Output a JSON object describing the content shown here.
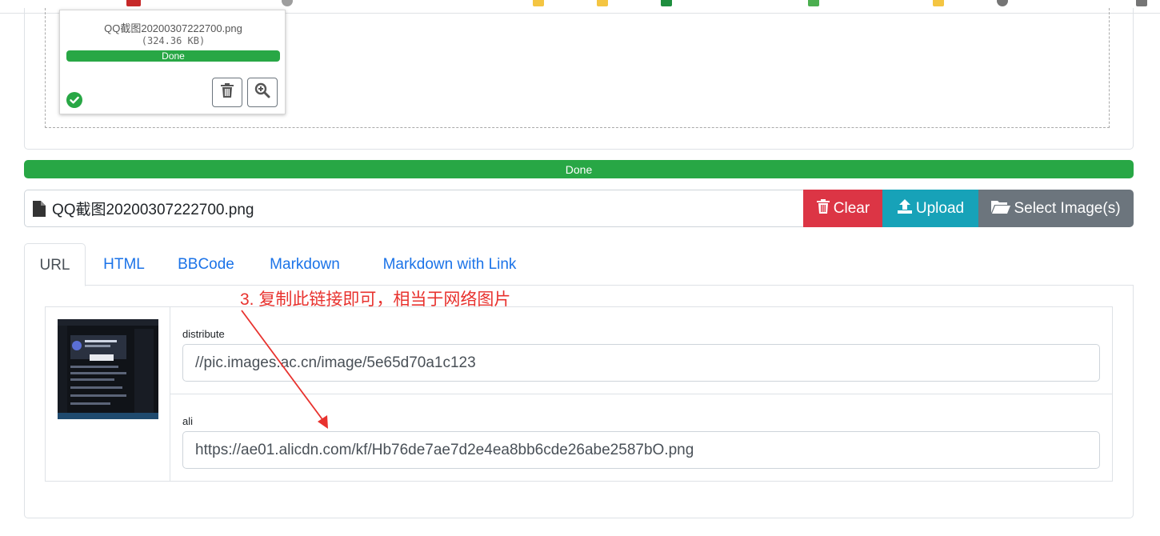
{
  "colors": {
    "success": "#28a745",
    "danger": "#dc3545",
    "info": "#17a2b8",
    "secondary": "#6c757d",
    "link": "#1b73e8",
    "annotation": "#e8322e"
  },
  "preview_card": {
    "filename": "QQ截图20200307222700.png",
    "size": "(324.36 KB)",
    "progress_label": "Done",
    "progress_value": 1.0,
    "status_icon": "check-circle-icon",
    "buttons": [
      {
        "icon": "trash-icon"
      },
      {
        "icon": "zoom-in-icon"
      }
    ]
  },
  "main_progress": {
    "label": "Done",
    "value": 1.0
  },
  "file_input": {
    "caption": "QQ截图20200307222700.png",
    "caption_icon": "file-icon",
    "clear_label": "Clear",
    "clear_icon": "trash-icon",
    "upload_label": "Upload",
    "upload_icon": "upload-icon",
    "select_label": "Select Image(s)",
    "select_icon": "folder-open-icon"
  },
  "tabs": [
    {
      "label": "URL",
      "active": true
    },
    {
      "label": "HTML",
      "active": false
    },
    {
      "label": "BBCode",
      "active": false
    },
    {
      "label": "Markdown",
      "active": false
    },
    {
      "label": "Markdown with Link",
      "active": false
    }
  ],
  "links": [
    {
      "label": "distribute",
      "value": "//pic.images.ac.cn/image/5e65d70a1c123"
    },
    {
      "label": "ali",
      "value": "https://ae01.alicdn.com/kf/Hb76de7ae7d2e4ea8bb6cde26abe2587bO.png"
    }
  ],
  "annotation": {
    "text": "3. 复制此链接即可，相当于网络图片"
  }
}
